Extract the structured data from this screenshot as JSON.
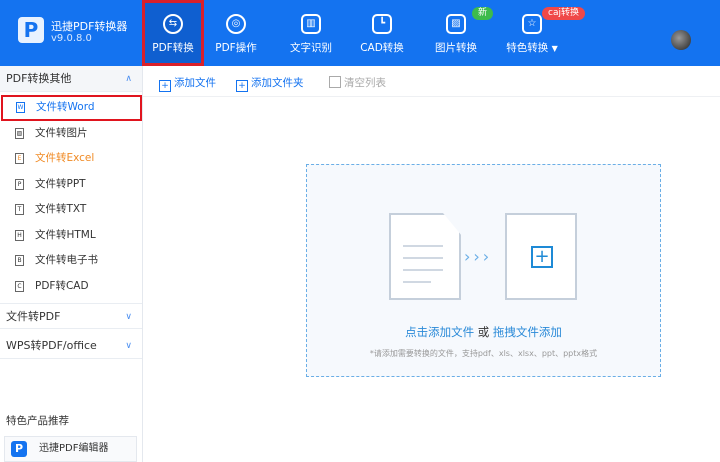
{
  "app": {
    "name": "迅捷PDF转换器",
    "version": "v9.0.8.0"
  },
  "nav": [
    {
      "label": "PDF转换",
      "icon": "⇆"
    },
    {
      "label": "PDF操作",
      "icon": "◎"
    },
    {
      "label": "文字识别",
      "icon": "▥"
    },
    {
      "label": "CAD转换",
      "icon": "┗"
    },
    {
      "label": "图片转换",
      "icon": "▨",
      "badge": "新"
    },
    {
      "label": "特色转换",
      "icon": "☆",
      "badge": "caj转换",
      "dropdown": "▼"
    }
  ],
  "colors": {
    "brand": "#1473f0",
    "badge_new": "#3dbb4c",
    "badge_caj": "#f04848"
  },
  "sidebar": {
    "section1": "PDF转换其他",
    "items": [
      {
        "label": "文件转Word",
        "icon": "W"
      },
      {
        "label": "文件转图片",
        "icon": "▨"
      },
      {
        "label": "文件转Excel",
        "icon": "E"
      },
      {
        "label": "文件转PPT",
        "icon": "P"
      },
      {
        "label": "文件转TXT",
        "icon": "T"
      },
      {
        "label": "文件转HTML",
        "icon": "H"
      },
      {
        "label": "文件转电子书",
        "icon": "B"
      },
      {
        "label": "PDF转CAD",
        "icon": "C"
      }
    ],
    "section2": "文件转PDF",
    "section3": "WPS转PDF/office",
    "recommend_title": "特色产品推荐",
    "recommend_item": "迅捷PDF编辑器",
    "chev_up": "∧",
    "chev_down": "∨"
  },
  "toolbar": {
    "add_file": "添加文件",
    "add_folder": "添加文件夹",
    "clear_list": "清空列表"
  },
  "drop": {
    "click_add": "点击添加文件",
    "or": "或",
    "drag_add": "拖拽文件添加",
    "hint": "*请添加需要转换的文件，支持pdf、xls、xlsx、ppt、pptx格式",
    "arrows": "›››",
    "plus": "+"
  }
}
